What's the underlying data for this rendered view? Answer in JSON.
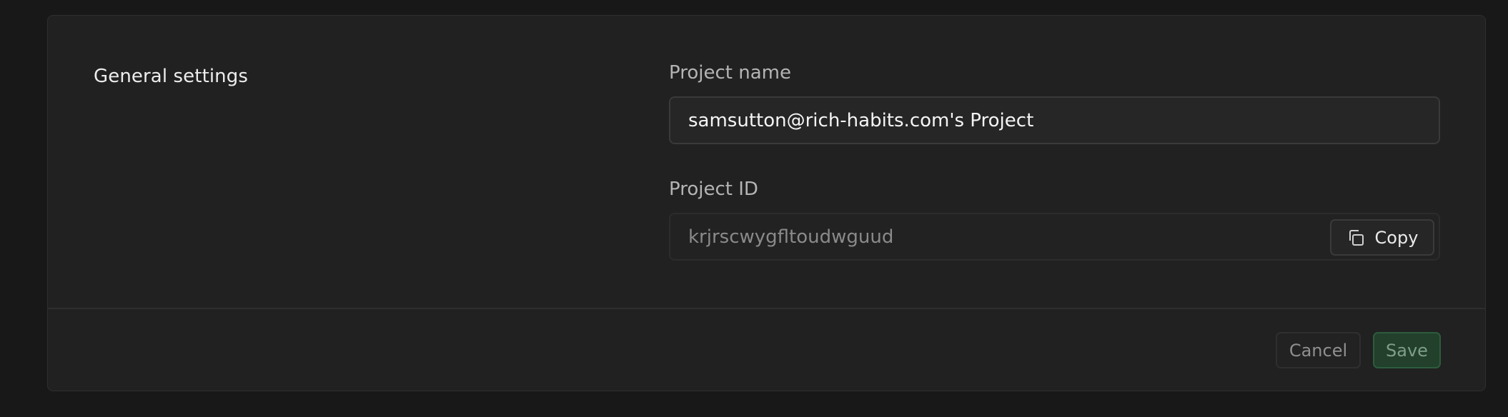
{
  "section": {
    "title": "General settings"
  },
  "fields": {
    "project_name": {
      "label": "Project name",
      "value": "samsutton@rich-habits.com's Project"
    },
    "project_id": {
      "label": "Project ID",
      "value": "krjrscwygfltoudwguud",
      "copy_label": "Copy",
      "copy_icon": "copy-icon"
    }
  },
  "footer": {
    "cancel_label": "Cancel",
    "save_label": "Save"
  },
  "colors": {
    "background": "#181818",
    "card": "#212121",
    "save_accent": "#22402c"
  }
}
